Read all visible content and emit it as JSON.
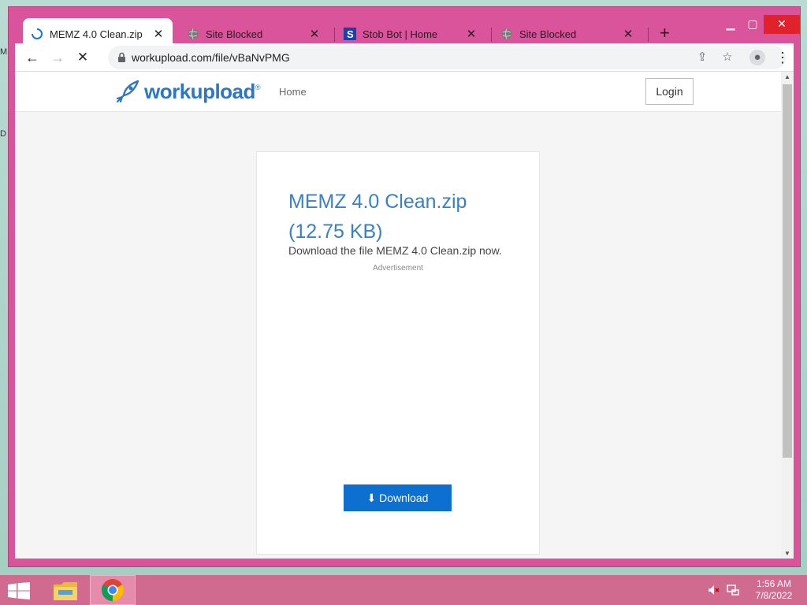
{
  "desktop": {
    "frag_top": "M",
    "frag_mid": "D"
  },
  "tabs": [
    {
      "title": "MEMZ 4.0 Clean.zip",
      "icon": "loading-spinner-icon",
      "active": true
    },
    {
      "title": "Site Blocked",
      "icon": "globe-icon",
      "active": false
    },
    {
      "title": "Stob Bot | Home",
      "icon": "stob-s-icon",
      "active": false
    },
    {
      "title": "Site Blocked",
      "icon": "globe-icon",
      "active": false
    }
  ],
  "toolbar": {
    "url": "workupload.com/file/vBaNvPMG"
  },
  "site": {
    "logo_text": "workupload",
    "logo_reg": "®",
    "nav_home": "Home",
    "login": "Login"
  },
  "file": {
    "title_line1": "MEMZ 4.0 Clean.zip",
    "title_line2": "(12.75 KB)",
    "description": "Download the file MEMZ 4.0 Clean.zip now.",
    "ad_label": "Advertisement",
    "download_label": "Download"
  },
  "taskbar": {
    "time": "1:56 AM",
    "date": "7/8/2022"
  },
  "colors": {
    "accent": "#d9549a",
    "link_blue": "#3a80c6",
    "download_btn": "#0d6fcf"
  }
}
